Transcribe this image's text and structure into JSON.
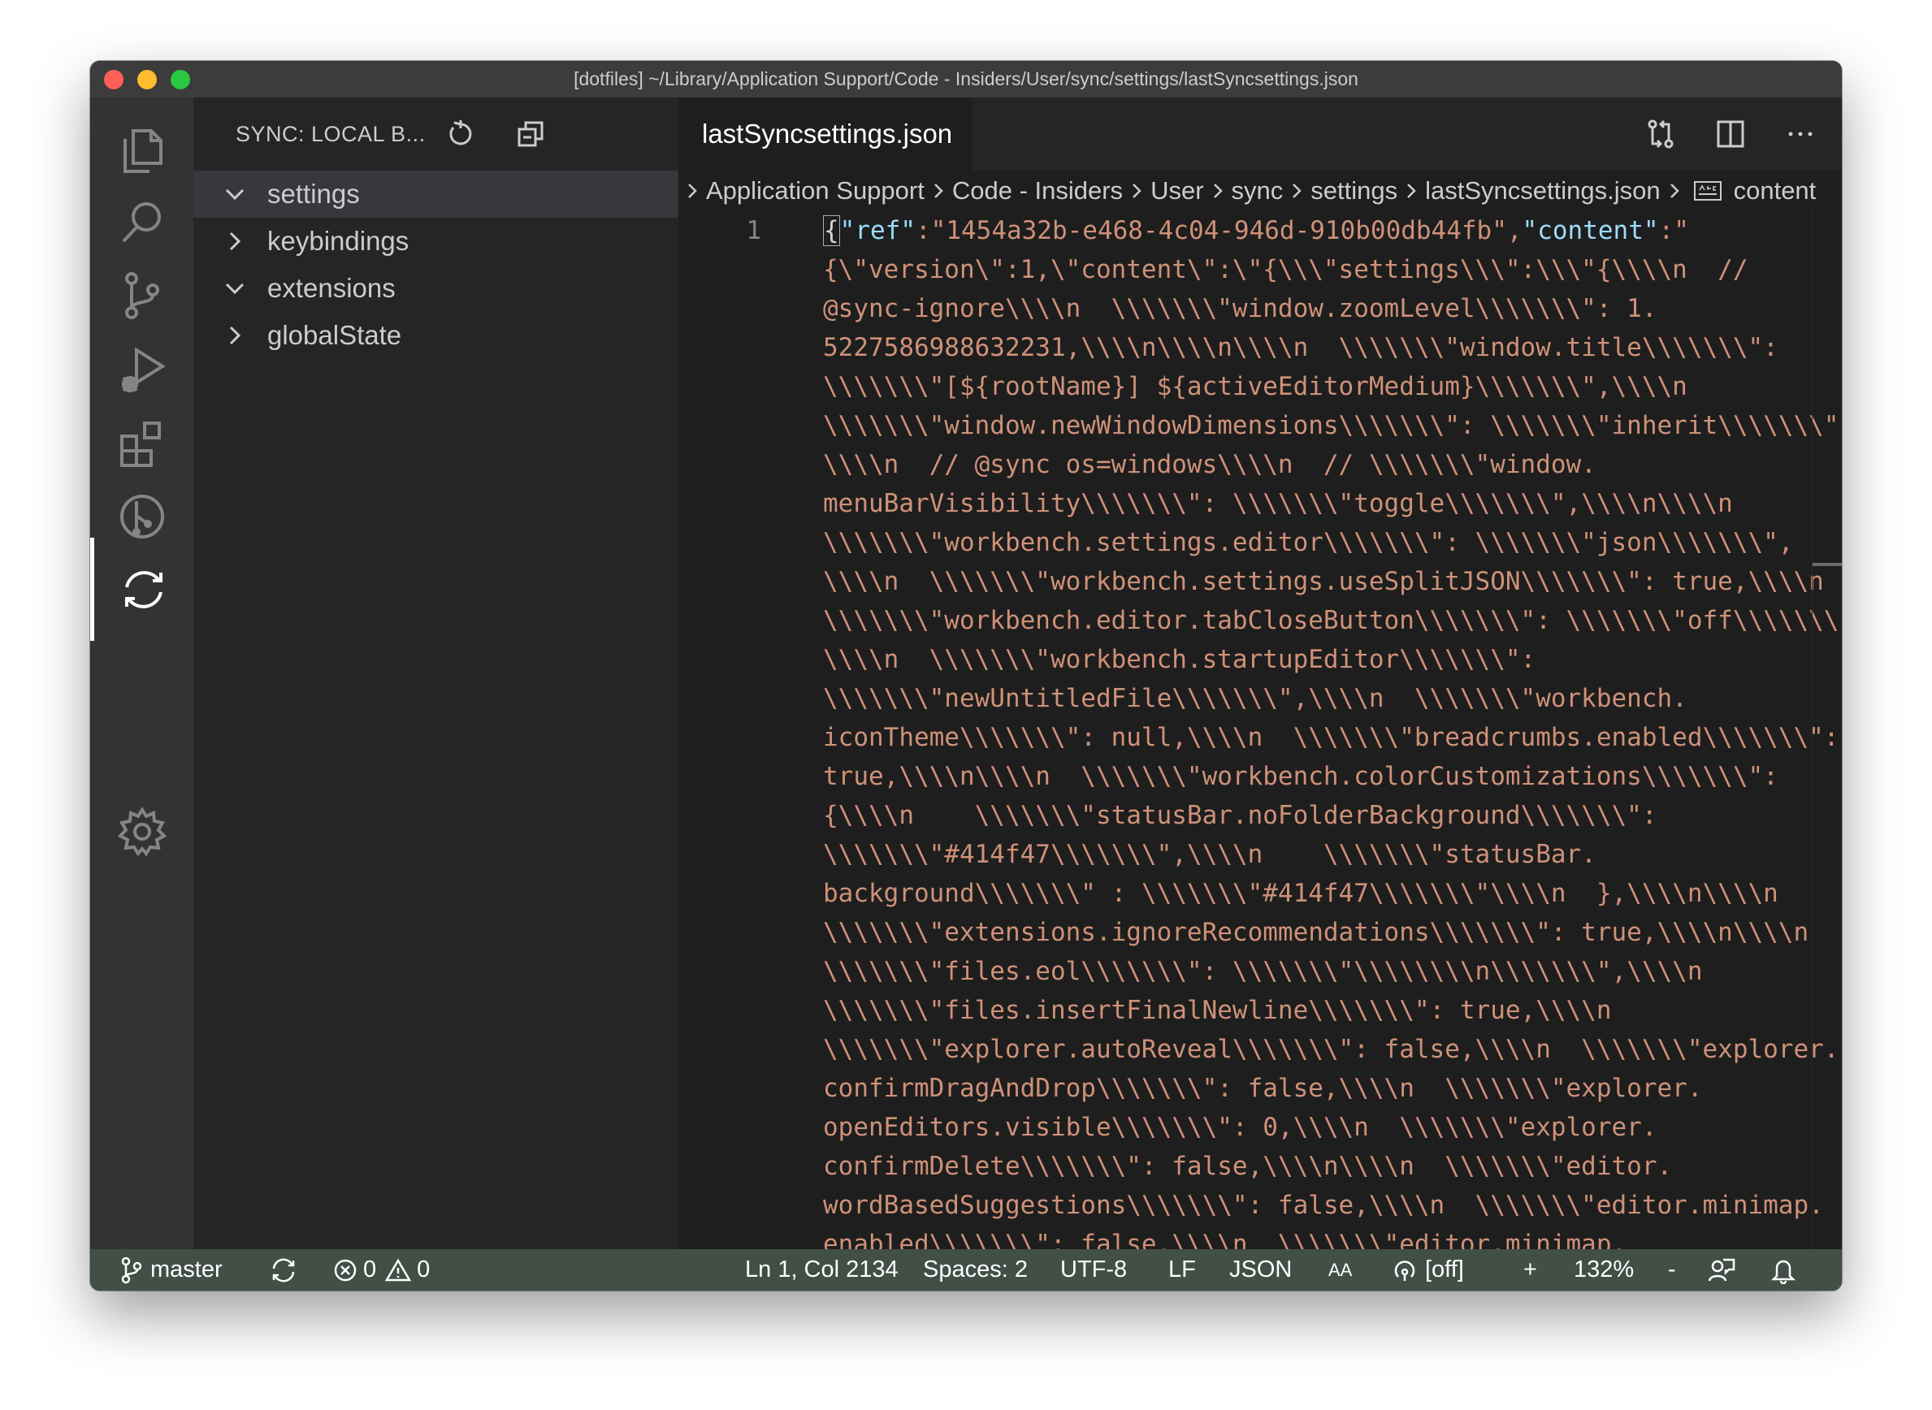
{
  "window": {
    "title": "[dotfiles] ~/Library/Application Support/Code - Insiders/User/sync/settings/lastSyncsettings.json"
  },
  "activity_bar": {
    "items": [
      {
        "icon": "files-icon"
      },
      {
        "icon": "search-icon"
      },
      {
        "icon": "source-control-icon"
      },
      {
        "icon": "run-debug-icon"
      },
      {
        "icon": "extensions-icon"
      },
      {
        "icon": "gitlens-icon"
      },
      {
        "icon": "sync-icon",
        "active": true
      },
      {
        "icon": "gear-icon"
      }
    ]
  },
  "sidebar": {
    "title": "SYNC: LOCAL B...",
    "tree": [
      {
        "label": "settings",
        "expanded": true,
        "selected": true
      },
      {
        "label": "keybindings",
        "expanded": false
      },
      {
        "label": "extensions",
        "expanded": true
      },
      {
        "label": "globalState",
        "expanded": false
      }
    ]
  },
  "editor": {
    "tab_label": "lastSyncsettings.json",
    "breadcrumbs": [
      "Application Support",
      "Code - Insiders",
      "User",
      "sync",
      "settings",
      "lastSyncsettings.json",
      "content"
    ],
    "line_number": "1",
    "code_lines": [
      "{\"ref\":\"1454a32b-e468-4c04-946d-910b00db44fb\",\"content\":\"",
      "{\\\"version\\\":1,\\\"content\\\":\\\"{\\\\\\\"settings\\\\\\\":\\\\\\\"{\\\\\\\\n  //",
      "@sync-ignore\\\\\\\\n  \\\\\\\\\\\\\\\"window.zoomLevel\\\\\\\\\\\\\\\": 1.",
      "5227586988632231,\\\\\\\\n\\\\\\\\n\\\\\\\\n  \\\\\\\\\\\\\\\"window.title\\\\\\\\\\\\\\\":",
      "\\\\\\\\\\\\\\\"[${rootName}] ${activeEditorMedium}\\\\\\\\\\\\\\\",\\\\\\\\n",
      "\\\\\\\\\\\\\\\"window.newWindowDimensions\\\\\\\\\\\\\\\": \\\\\\\\\\\\\\\"inherit\\\\\\\\\\\\\\\",",
      "\\\\\\\\n  // @sync os=windows\\\\\\\\n  // \\\\\\\\\\\\\\\"window.",
      "menuBarVisibility\\\\\\\\\\\\\\\": \\\\\\\\\\\\\\\"toggle\\\\\\\\\\\\\\\",\\\\\\\\n\\\\\\\\n",
      "\\\\\\\\\\\\\\\"workbench.settings.editor\\\\\\\\\\\\\\\": \\\\\\\\\\\\\\\"json\\\\\\\\\\\\\\\",",
      "\\\\\\\\n  \\\\\\\\\\\\\\\"workbench.settings.useSplitJSON\\\\\\\\\\\\\\\": true,\\\\\\\\n",
      "\\\\\\\\\\\\\\\"workbench.editor.tabCloseButton\\\\\\\\\\\\\\\": \\\\\\\\\\\\\\\"off\\\\\\\\\\\\\\\",",
      "\\\\\\\\n  \\\\\\\\\\\\\\\"workbench.startupEditor\\\\\\\\\\\\\\\":",
      "\\\\\\\\\\\\\\\"newUntitledFile\\\\\\\\\\\\\\\",\\\\\\\\n  \\\\\\\\\\\\\\\"workbench.",
      "iconTheme\\\\\\\\\\\\\\\": null,\\\\\\\\n  \\\\\\\\\\\\\\\"breadcrumbs.enabled\\\\\\\\\\\\\\\":",
      "true,\\\\\\\\n\\\\\\\\n  \\\\\\\\\\\\\\\"workbench.colorCustomizations\\\\\\\\\\\\\\\":",
      "{\\\\\\\\n    \\\\\\\\\\\\\\\"statusBar.noFolderBackground\\\\\\\\\\\\\\\":",
      "\\\\\\\\\\\\\\\"#414f47\\\\\\\\\\\\\\\",\\\\\\\\n    \\\\\\\\\\\\\\\"statusBar.",
      "background\\\\\\\\\\\\\\\" : \\\\\\\\\\\\\\\"#414f47\\\\\\\\\\\\\\\"\\\\\\\\n  },\\\\\\\\n\\\\\\\\n",
      "\\\\\\\\\\\\\\\"extensions.ignoreRecommendations\\\\\\\\\\\\\\\": true,\\\\\\\\n\\\\\\\\n",
      "\\\\\\\\\\\\\\\"files.eol\\\\\\\\\\\\\\\": \\\\\\\\\\\\\\\"\\\\\\\\\\\\\\\\n\\\\\\\\\\\\\\\",\\\\\\\\n",
      "\\\\\\\\\\\\\\\"files.insertFinalNewline\\\\\\\\\\\\\\\": true,\\\\\\\\n",
      "\\\\\\\\\\\\\\\"explorer.autoReveal\\\\\\\\\\\\\\\": false,\\\\\\\\n  \\\\\\\\\\\\\\\"explorer.",
      "confirmDragAndDrop\\\\\\\\\\\\\\\": false,\\\\\\\\n  \\\\\\\\\\\\\\\"explorer.",
      "openEditors.visible\\\\\\\\\\\\\\\": 0,\\\\\\\\n  \\\\\\\\\\\\\\\"explorer.",
      "confirmDelete\\\\\\\\\\\\\\\": false,\\\\\\\\n\\\\\\\\n  \\\\\\\\\\\\\\\"editor.",
      "wordBasedSuggestions\\\\\\\\\\\\\\\": false,\\\\\\\\n  \\\\\\\\\\\\\\\"editor.minimap.",
      "enabled\\\\\\\\\\\\\\\": false,\\\\\\\\n  \\\\\\\\\\\\\\\"editor.minimap."
    ]
  },
  "statusbar": {
    "branch": "master",
    "errors": "0",
    "warnings": "0",
    "position": "Ln 1, Col 2134",
    "spaces": "Spaces: 2",
    "encoding": "UTF-8",
    "eol": "LF",
    "language": "JSON",
    "case_toggle": "AA",
    "live_share": "[off]",
    "zoom_in": "+",
    "zoom": "132%",
    "zoom_out": "-"
  },
  "colors": {
    "statusbar": "#414f47",
    "activitybar": "#333333",
    "sidebar": "#252526",
    "editor": "#1e1e1e",
    "string": "#ce9178",
    "key": "#9cdcfe"
  }
}
